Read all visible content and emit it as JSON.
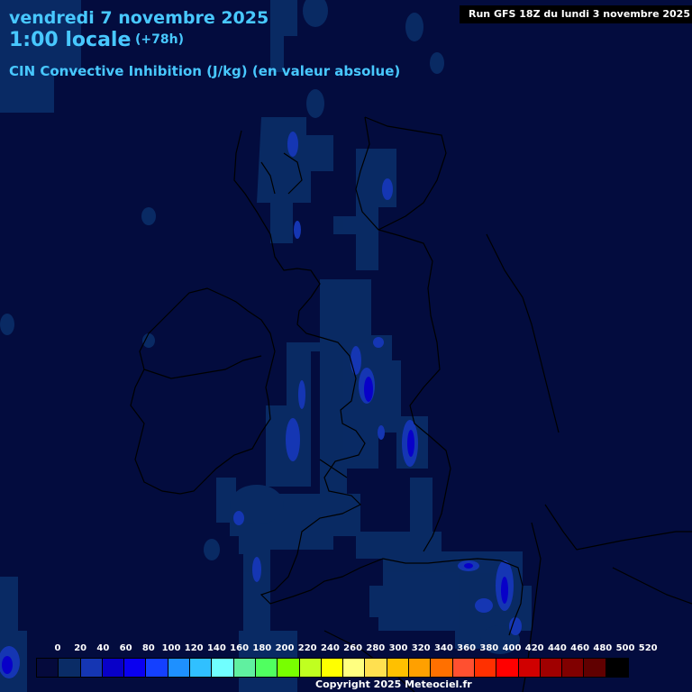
{
  "header": {
    "date_line": "vendredi 7 novembre 2025",
    "time_line": "1:00 locale",
    "forecast_hour": "(+78h)",
    "parameter": "CIN Convective Inhibition (J/kg) (en valeur absolue)",
    "run_info": "Run GFS 18Z du lundi 3 novembre 2025"
  },
  "legend": {
    "labels": [
      "0",
      "20",
      "40",
      "60",
      "80",
      "100",
      "120",
      "140",
      "160",
      "180",
      "200",
      "220",
      "240",
      "260",
      "280",
      "300",
      "320",
      "340",
      "360",
      "380",
      "400",
      "420",
      "440",
      "460",
      "480",
      "500",
      "520"
    ],
    "colors": [
      "#050a3c",
      "#0a2c66",
      "#1536b3",
      "#0800c8",
      "#0a00f0",
      "#1440ff",
      "#1e90ff",
      "#30c0ff",
      "#70ffff",
      "#60f0a0",
      "#50ff60",
      "#78ff00",
      "#c0ff20",
      "#ffff00",
      "#ffff80",
      "#ffe050",
      "#ffc000",
      "#ffa000",
      "#ff7000",
      "#ff5030",
      "#ff3000",
      "#ff0000",
      "#d00000",
      "#a00000",
      "#800000",
      "#600000",
      "#000000"
    ]
  },
  "copyright": "Copyright 2025 Meteociel.fr"
}
